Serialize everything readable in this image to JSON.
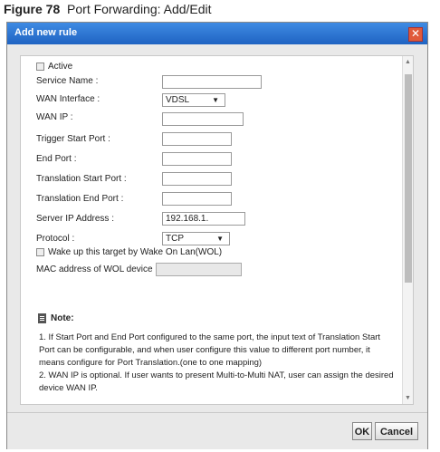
{
  "caption": {
    "figure": "Figure 78",
    "text": "Port Forwarding: Add/Edit"
  },
  "dialog": {
    "title": "Add new rule",
    "close_glyph": "✕"
  },
  "form": {
    "active_label": "Active",
    "service_name_label": "Service Name :",
    "service_name_value": "",
    "wan_interface_label": "WAN Interface :",
    "wan_interface_value": "VDSL",
    "wan_ip_label": "WAN IP :",
    "wan_ip_value": "",
    "trigger_start_label": "Trigger Start Port :",
    "end_port_label": "End Port :",
    "translation_start_label": "Translation Start Port :",
    "translation_end_label": "Translation End Port :",
    "server_ip_label": "Server IP Address :",
    "server_ip_value": "192.168.1.",
    "protocol_label": "Protocol :",
    "protocol_value": "TCP",
    "wol_label": "Wake up this target by Wake On Lan(WOL)",
    "mac_label": "MAC address of WOL device",
    "dropdown_arrow": "▼"
  },
  "note": {
    "title": "Note:",
    "lines": [
      "1.  If Start Port and End Port configured to the same port, the input text of Translation Start Port can be configurable, and when user configure this value to different port number, it means configure for Port Translation.(one to one mapping)",
      "2.  WAN IP is optional. If user wants to present Multi-to-Multi NAT, user can assign the desired device WAN IP."
    ]
  },
  "footer": {
    "ok_label": "OK",
    "cancel_label": "Cancel"
  },
  "colors": {
    "titlebar": "#2f76d6",
    "close": "#e05a3a"
  }
}
